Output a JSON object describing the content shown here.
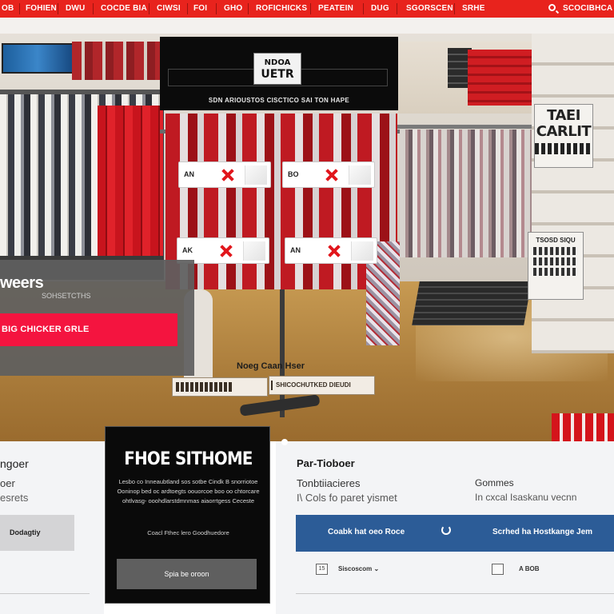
{
  "nav": {
    "items": [
      "OB",
      "FOHIEN",
      "DWU",
      "COCDE BIA",
      "CIWSI",
      "FOI",
      "GHO",
      "ROFICHICKS",
      "PEATEIN",
      "DUG",
      "SGORSCEN",
      "SRHE"
    ],
    "account_label": "SCOCIBHCA",
    "bar_color": "#e8231d"
  },
  "promo": {
    "logo_line1": "NDOA",
    "logo_line2": "UETR",
    "tagline": "SDN ARIOUSTOS CISCTICO SAI TON HAPE"
  },
  "rack_tags": [
    {
      "label": "AN"
    },
    {
      "label": "BO"
    },
    {
      "label": "AK"
    },
    {
      "label": "AN"
    }
  ],
  "wall_signs": {
    "sale_line1": "TAEI",
    "sale_line2": "CARLIT",
    "small_text": "TSOSD SIQU"
  },
  "left_panel": {
    "heading": "weers",
    "subtext": "SOHSETCTHS",
    "cta_label": "BIG CHICKER GRLE",
    "cta_color": "#f4143f"
  },
  "floor": {
    "label": "Noeg Caan Hser",
    "card_b": "SHICOCHUTKED DIEUDI"
  },
  "bottom_left": {
    "title": "ngoer",
    "line1": "oer",
    "line2": "esrets",
    "button_label": "Dodagtiy"
  },
  "feature": {
    "title": "FHOE SITHOME",
    "body": "Lesbo co Inneaubtland sos sotbe Cindk B snorriotoe Ooninop bed oc ardtoegts oouorcoe boo oo chtorcare ohtlvasg- ooohdlarstdmnmas aiaorrtgess Ceceste",
    "note": "Coacl Fthec lero Goodhuedore",
    "button_label": "Spia be oroon"
  },
  "bottom_right": {
    "title": "Par-Tioboer",
    "col1_line1": "Tonbtiiacieres",
    "col1_line2": "I\\ Cols fo paret yismet",
    "col2_line1": "Gommes",
    "col2_line2": "In cxcal Isaskanu vecnn",
    "blue_left": "Coabk hat oeo Roce",
    "blue_right": "Scrhed ha Hostkange Jem",
    "blue_color": "#2c5c97",
    "ctrl1_icon": "15",
    "ctrl1_label": "Siscoscom",
    "ctrl2_label": "A BOB"
  }
}
